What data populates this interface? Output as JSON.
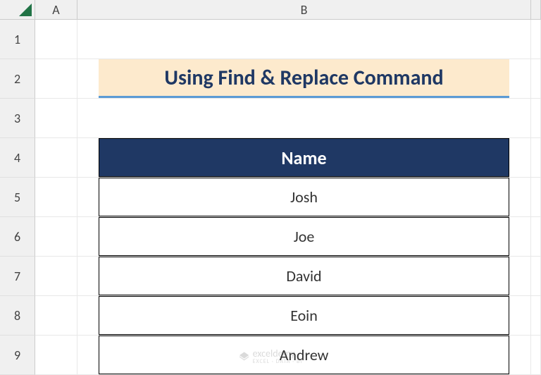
{
  "columns": [
    "A",
    "B"
  ],
  "rows": [
    "1",
    "2",
    "3",
    "4",
    "5",
    "6",
    "7",
    "8",
    "9"
  ],
  "title": "Using Find & Replace Command",
  "table": {
    "header": "Name",
    "data": [
      "Josh",
      "Joe",
      "David",
      "Eoin",
      "Andrew"
    ]
  },
  "watermark": {
    "brand": "exceldemy",
    "tagline": "EXCEL · DATA · BI"
  }
}
